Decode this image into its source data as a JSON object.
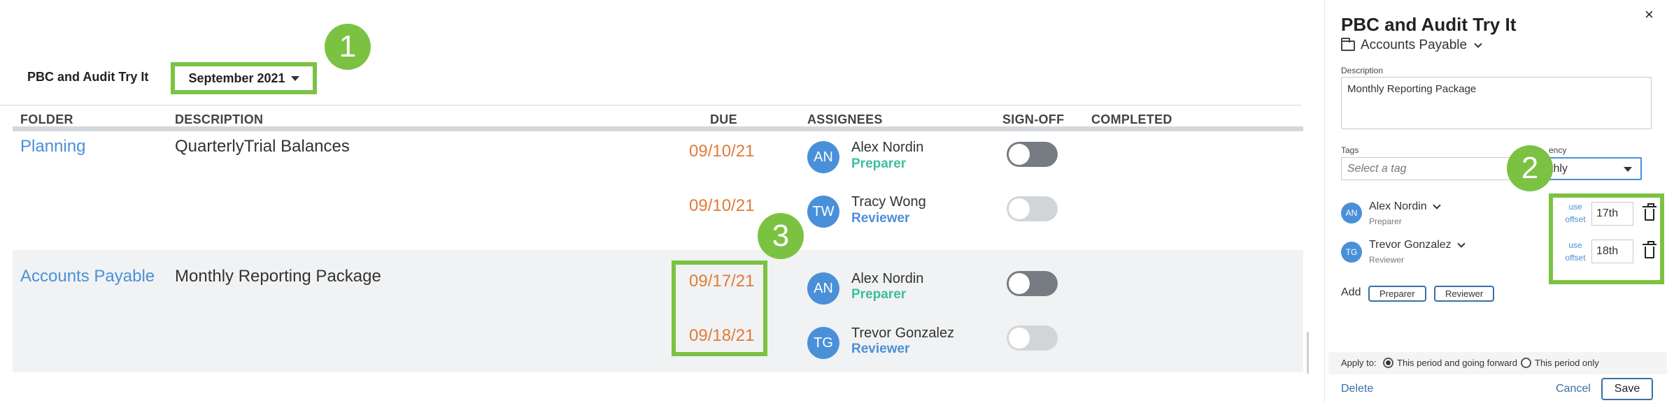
{
  "main": {
    "app_title": "PBC and Audit Try It",
    "period": "September 2021",
    "columns": {
      "folder": "FOLDER",
      "description": "DESCRIPTION",
      "due": "DUE",
      "assignees": "ASSIGNEES",
      "signoff": "SIGN-OFF",
      "completed": "COMPLETED"
    },
    "rows": [
      {
        "folder": "Planning",
        "description": "QuarterlyTrial Balances",
        "assignments": [
          {
            "due": "09/10/21",
            "initials": "AN",
            "name": "Alex Nordin",
            "role": "Preparer",
            "signed": true
          },
          {
            "due": "09/10/21",
            "initials": "TW",
            "name": "Tracy Wong",
            "role": "Reviewer",
            "signed": false
          }
        ]
      },
      {
        "folder": "Accounts Payable",
        "description": "Monthly Reporting Package",
        "assignments": [
          {
            "due": "09/17/21",
            "initials": "AN",
            "name": "Alex Nordin",
            "role": "Preparer",
            "signed": true
          },
          {
            "due": "09/18/21",
            "initials": "TG",
            "name": "Trevor Gonzalez",
            "role": "Reviewer",
            "signed": false
          }
        ]
      }
    ]
  },
  "callouts": [
    "1",
    "2",
    "3"
  ],
  "panel": {
    "title": "PBC and Audit Try It",
    "folder": "Accounts Payable",
    "description_label": "Description",
    "description_value": "Monthly Reporting Package",
    "tags_label": "Tags",
    "tags_placeholder": "Select a tag",
    "frequency_label": "ency",
    "frequency_value": "thly",
    "assignees": [
      {
        "initials": "AN",
        "name": "Alex Nordin",
        "role": "Preparer",
        "offset_link_line1": "use",
        "offset_link_line2": "offset",
        "offset": "17th"
      },
      {
        "initials": "TG",
        "name": "Trevor Gonzalez",
        "role": "Reviewer",
        "offset_link_line1": "use",
        "offset_link_line2": "offset",
        "offset": "18th"
      }
    ],
    "add_label": "Add",
    "add_preparer": "Preparer",
    "add_reviewer": "Reviewer",
    "apply_to_label": "Apply to:",
    "apply_options": [
      "This period and going forward",
      "This period only"
    ],
    "apply_selected": "This period and going forward",
    "delete": "Delete",
    "cancel": "Cancel",
    "save": "Save",
    "close": "×"
  },
  "colors": {
    "accent_green": "#7cc242",
    "link_blue": "#4a90d9",
    "due_orange": "#e07b39",
    "preparer_teal": "#3dbf9e"
  }
}
